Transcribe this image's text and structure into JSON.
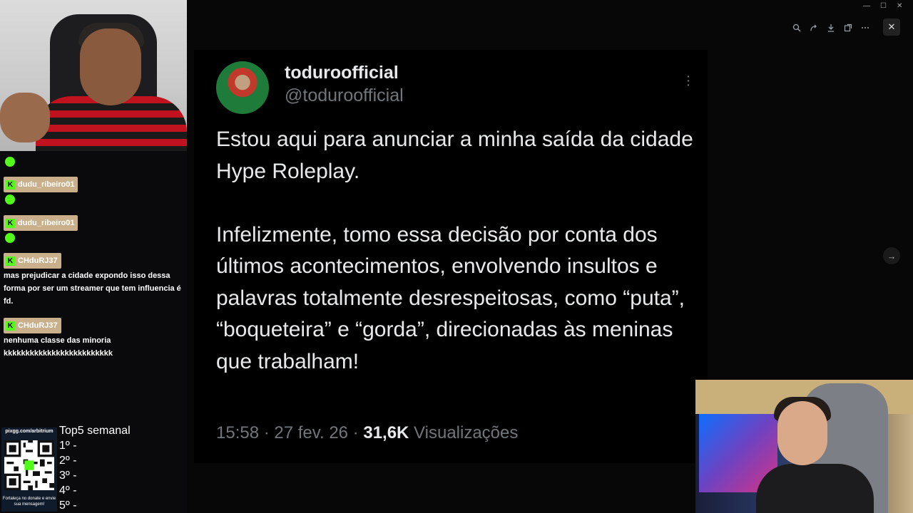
{
  "tweet": {
    "display_name": "toduroofficial",
    "handle": "@toduroofficial",
    "text": "Estou aqui para anunciar a minha saída da cidade Hype Roleplay.\n\nInfelizmente, tomo essa decisão por conta dos últimos acontecimentos, envolvendo insultos e palavras totalmente desrespeitosas, como “puta”, “boqueteira” e “gorda”, direcionadas às meninas que trabalham!",
    "time": "15:58 · 27 fev. 26 · ",
    "views_count": "31,6K",
    "views_label": " Visualizações"
  },
  "chat": {
    "messages": [
      {
        "user": "dudu_ribeiro01",
        "text": ""
      },
      {
        "user": "dudu_ribeiro01",
        "text": ""
      },
      {
        "user": "CHduRJ37",
        "text": "mas prejudicar a cidade expondo isso dessa forma por ser um streamer que tem influencia é fd."
      },
      {
        "user": "CHduRJ37",
        "text": "nenhuma classe das minoria kkkkkkkkkkkkkkkkkkkkkkkkk"
      }
    ]
  },
  "qr": {
    "url": "pixgg.com/arbitrium",
    "caption": "Fortaleça no donate e envie sua mensagem!"
  },
  "top5": {
    "title": "Top5 semanal",
    "ranks": [
      "1º -",
      "2º -",
      "3º -",
      "4º -",
      "5º -"
    ]
  },
  "viewer": {
    "toolbar_icons": [
      "zoom-in-icon",
      "share-icon",
      "download-icon",
      "open-new-icon",
      "more-icon"
    ],
    "close_glyph": "✕",
    "next_glyph": "→"
  }
}
